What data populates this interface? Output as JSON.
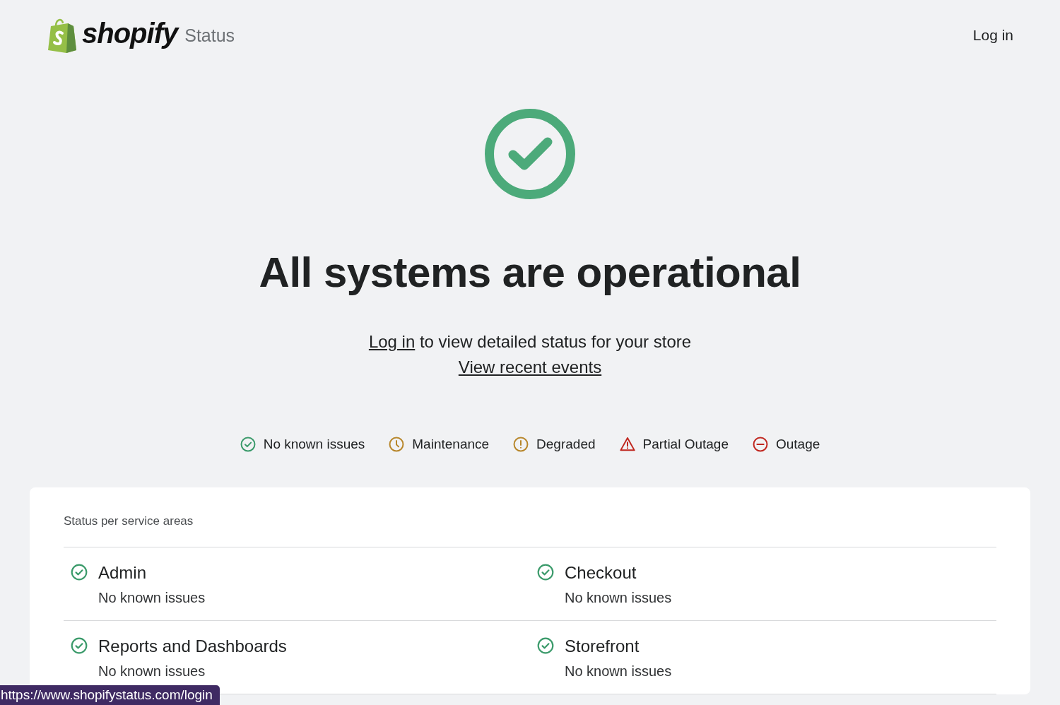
{
  "header": {
    "brand": "shopify",
    "product": "Status",
    "login_link": "Log in"
  },
  "hero": {
    "kind": "ok",
    "headline": "All systems are operational",
    "login_link": "Log in",
    "login_text": "to view detailed status for your store",
    "events_link": "View recent events"
  },
  "legend": [
    {
      "kind": "ok",
      "label": "No known issues"
    },
    {
      "kind": "maintenance",
      "label": "Maintenance"
    },
    {
      "kind": "degraded",
      "label": "Degraded"
    },
    {
      "kind": "partial",
      "label": "Partial Outage"
    },
    {
      "kind": "outage",
      "label": "Outage"
    }
  ],
  "services": {
    "title": "Status per service areas",
    "items": [
      {
        "kind": "ok",
        "name": "Admin",
        "status": "No known issues"
      },
      {
        "kind": "ok",
        "name": "Checkout",
        "status": "No known issues"
      },
      {
        "kind": "ok",
        "name": "Reports and Dashboards",
        "status": "No known issues"
      },
      {
        "kind": "ok",
        "name": "Storefront",
        "status": "No known issues"
      }
    ]
  },
  "link_preview": "https://www.shopifystatus.com/login"
}
